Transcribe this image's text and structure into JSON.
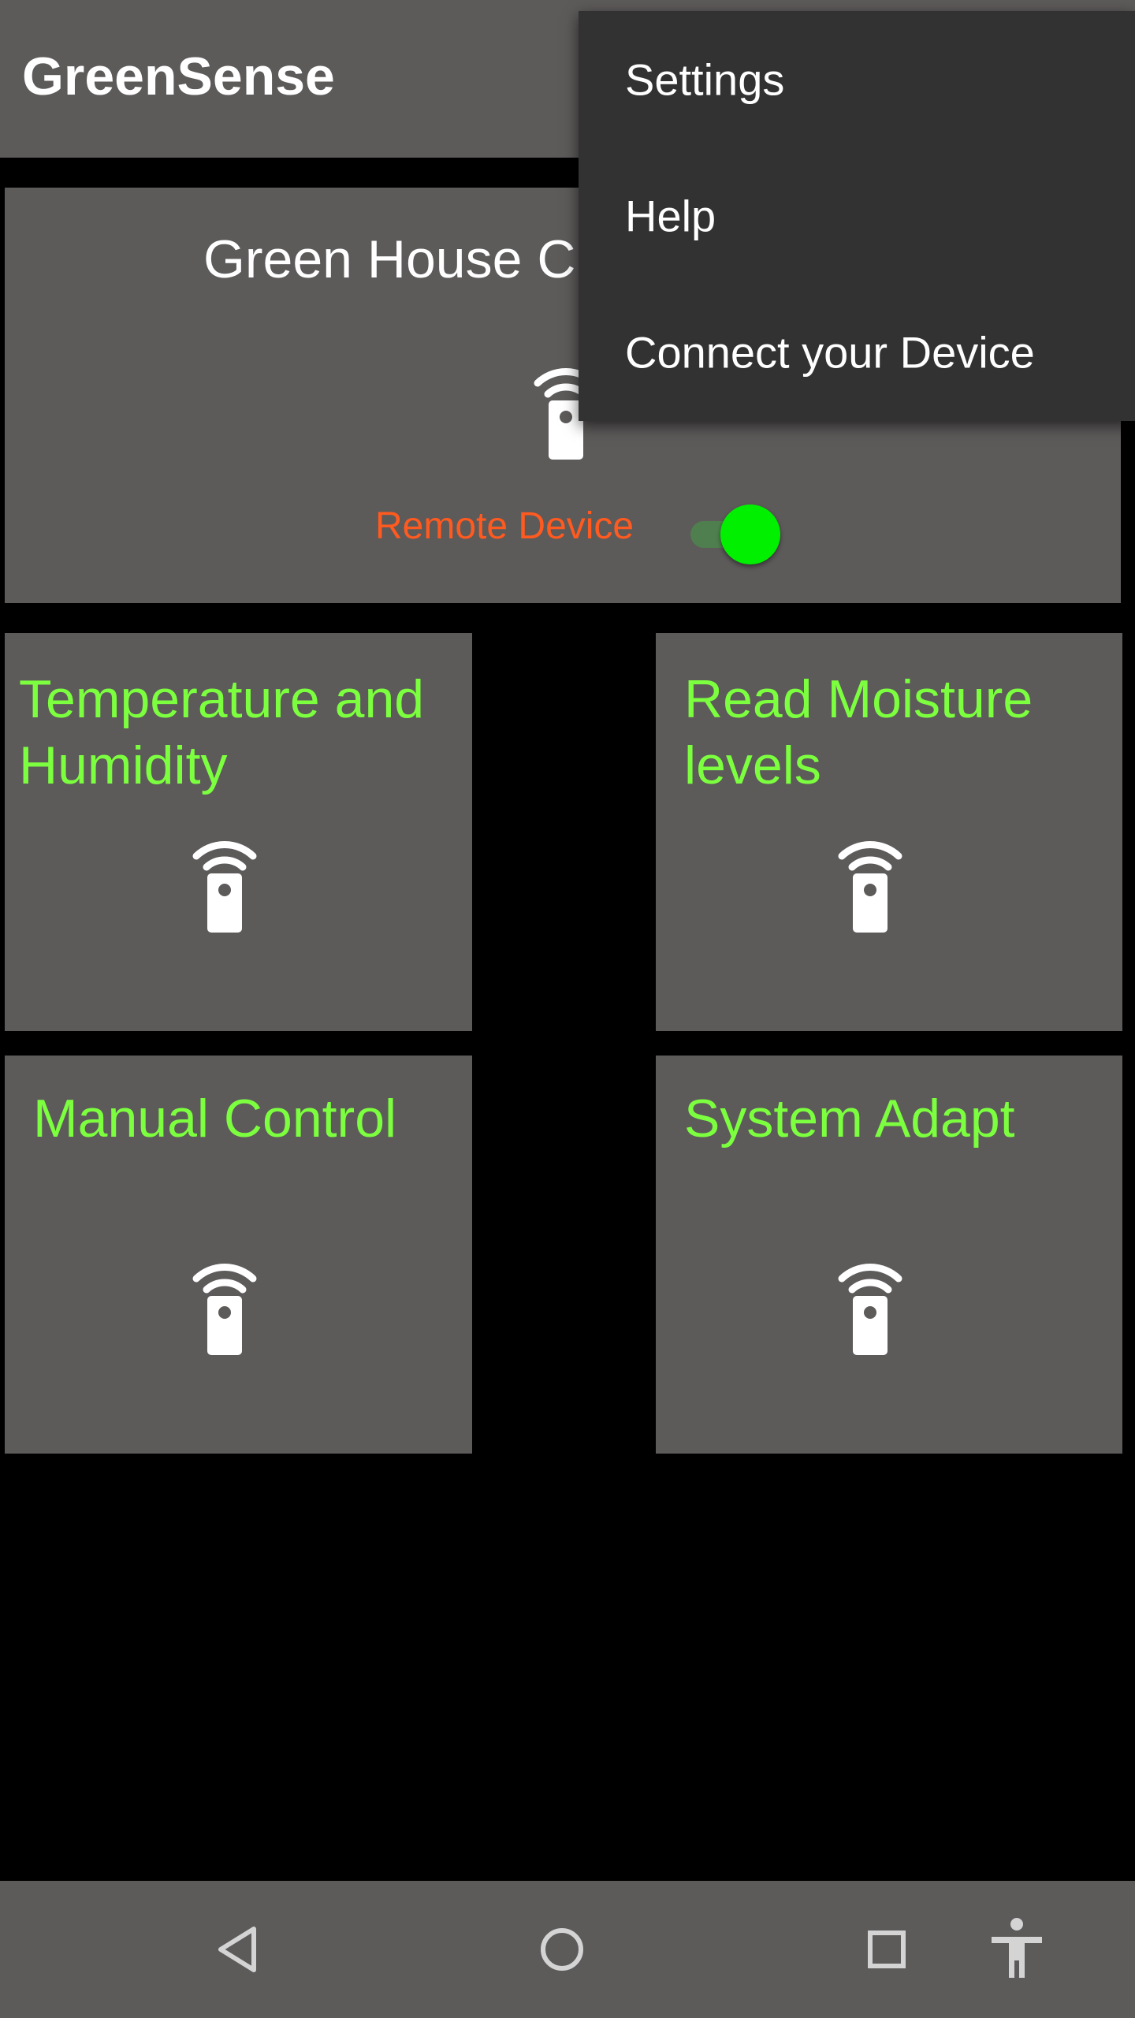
{
  "app_bar": {
    "title": "GreenSense"
  },
  "main_card": {
    "title": "Green House C",
    "icon": "remote-device-icon",
    "remote_label": "Remote Device",
    "remote_toggle_on": true
  },
  "tiles": [
    {
      "title": "Temperature and\nHumidity",
      "icon": "remote-device-icon"
    },
    {
      "title": "Read Moisture\nlevels",
      "icon": "remote-device-icon"
    },
    {
      "title": "Manual Control",
      "icon": "remote-device-icon"
    },
    {
      "title": "System Adapt",
      "icon": "remote-device-icon"
    }
  ],
  "overflow_menu": {
    "items": [
      {
        "label": "Settings"
      },
      {
        "label": "Help"
      },
      {
        "label": "Connect your Device"
      }
    ]
  },
  "nav_bar": {
    "buttons": [
      "back-icon",
      "home-icon",
      "recents-icon",
      "accessibility-icon"
    ]
  },
  "colors": {
    "surface": "#5d5a5a",
    "background": "#000000",
    "tile_text": "#7bff3e",
    "remote_label": "#ff5a1f",
    "toggle_thumb": "#00f000",
    "menu_bg": "#323232"
  }
}
